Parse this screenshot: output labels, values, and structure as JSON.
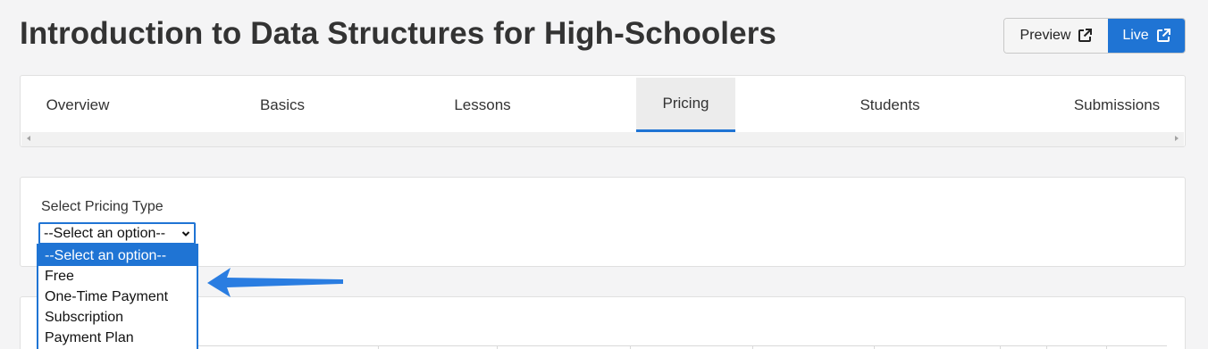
{
  "header": {
    "title": "Introduction to Data Structures for High-Schoolers",
    "preview_label": "Preview",
    "live_label": "Live"
  },
  "tabs": [
    {
      "label": "Overview",
      "active": false
    },
    {
      "label": "Basics",
      "active": false
    },
    {
      "label": "Lessons",
      "active": false
    },
    {
      "label": "Pricing",
      "active": true
    },
    {
      "label": "Students",
      "active": false
    },
    {
      "label": "Submissions",
      "active": false
    }
  ],
  "pricing": {
    "field_label": "Select Pricing Type",
    "selected_value": "--Select an option--",
    "options": [
      "--Select an option--",
      "Free",
      "One-Time Payment",
      "Subscription",
      "Payment Plan"
    ]
  },
  "colors": {
    "accent": "#1f74d4",
    "background": "#f4f4f5"
  },
  "icons": {
    "external_link": "external-link-icon",
    "chevron": "chevron-down-icon",
    "annotation_arrow": "arrow-left-icon"
  }
}
